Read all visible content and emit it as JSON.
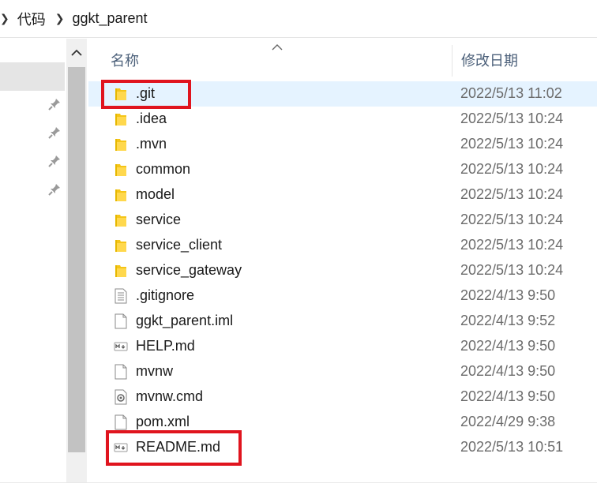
{
  "breadcrumb": {
    "items": [
      "代码",
      "ggkt_parent"
    ]
  },
  "columns": {
    "name": "名称",
    "date_modified": "修改日期"
  },
  "files": [
    {
      "name": ".git",
      "date": "2022/5/13 11:02",
      "icon": "folder-icon",
      "selected": true,
      "highlighted": true
    },
    {
      "name": ".idea",
      "date": "2022/5/13 10:24",
      "icon": "folder-icon"
    },
    {
      "name": ".mvn",
      "date": "2022/5/13 10:24",
      "icon": "folder-icon"
    },
    {
      "name": "common",
      "date": "2022/5/13 10:24",
      "icon": "folder-icon"
    },
    {
      "name": "model",
      "date": "2022/5/13 10:24",
      "icon": "folder-icon"
    },
    {
      "name": "service",
      "date": "2022/5/13 10:24",
      "icon": "folder-icon"
    },
    {
      "name": "service_client",
      "date": "2022/5/13 10:24",
      "icon": "folder-icon"
    },
    {
      "name": "service_gateway",
      "date": "2022/5/13 10:24",
      "icon": "folder-icon"
    },
    {
      "name": ".gitignore",
      "date": "2022/4/13 9:50",
      "icon": "text-file-icon"
    },
    {
      "name": "ggkt_parent.iml",
      "date": "2022/4/13 9:52",
      "icon": "blank-file-icon"
    },
    {
      "name": "HELP.md",
      "date": "2022/4/13 9:50",
      "icon": "markdown-file-icon"
    },
    {
      "name": "mvnw",
      "date": "2022/4/13 9:50",
      "icon": "blank-file-icon"
    },
    {
      "name": "mvnw.cmd",
      "date": "2022/4/13 9:50",
      "icon": "cmd-file-icon"
    },
    {
      "name": "pom.xml",
      "date": "2022/4/29 9:38",
      "icon": "blank-file-icon"
    },
    {
      "name": "README.md",
      "date": "2022/5/13 10:51",
      "icon": "markdown-file-icon",
      "highlighted": true
    }
  ],
  "nav": {
    "pin_count": 4,
    "pin_icon": "pin-icon"
  },
  "colors": {
    "highlight": "#e0141e",
    "selected_row": "#e5f3ff",
    "folder": "#f5c518"
  }
}
